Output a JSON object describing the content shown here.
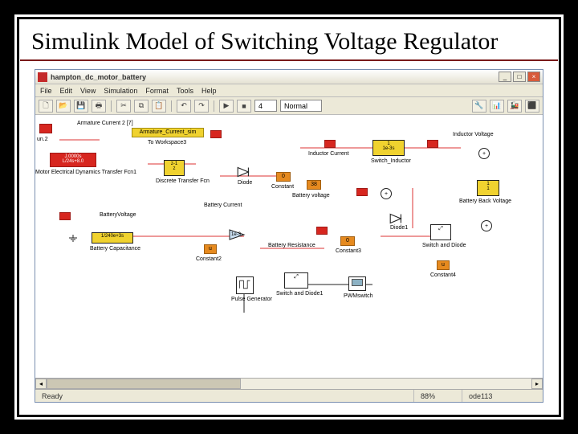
{
  "slide": {
    "title": "Simulink Model of Switching Voltage Regulator"
  },
  "window": {
    "title": "hampton_dc_motor_battery",
    "min": "_",
    "max": "□",
    "close": "×"
  },
  "menu": {
    "file": "File",
    "edit": "Edit",
    "view": "View",
    "simulation": "Simulation",
    "format": "Format",
    "tools": "Tools",
    "help": "Help"
  },
  "toolbar": {
    "stoptime": "4",
    "mode": "Normal",
    "play": "▶",
    "stop": "■"
  },
  "status": {
    "left": "Ready",
    "mid": "88%",
    "right": "ode113"
  },
  "blocks": {
    "arm_current": "Armature Current 2 [7]",
    "arm_current_sim": "Armature_Current_sim",
    "to_workspace": "To Workspace3",
    "motor_tf_val": "J.0000s\nL/24s+8.0",
    "motor_tf": "Motor Electrical Dynamics Transfer Fcn1",
    "discrete_tf_val": "z-1\nz",
    "discrete_tf": "Discrete Transfer Fcn",
    "diode": "Diode",
    "constant": "Constant",
    "ind_current": "Inductor Current",
    "switch_ind_val": "1\n1e-3s",
    "switch_ind": "Switch_Inductor",
    "ind_voltage": "Inductor Voltage",
    "batt_current": "Battery Current",
    "batt_voltage_top": "Battery voltage",
    "batt_voltage_lbl": "BatteryVoltage",
    "gain_val": "1e-3",
    "batt_cap_val": "1/240e+3s",
    "batt_cap": "Battery Capacitance",
    "constant2": "Constant2",
    "batt_res": "Battery Resistance",
    "constant_38": "38",
    "constant_0_val": "0",
    "constant_u": "u",
    "constant3": "Constant3",
    "constant4": "Constant4",
    "diode1": "Diode1",
    "switch_and_diode": "Switch and Diode",
    "switch_and_diode1": "Switch and Diode1",
    "batt_back_v_val": "1\n1",
    "batt_back_v": "Battery Back Voltage",
    "pulse": "Pulse Generator",
    "pwm": "PWMswitch"
  }
}
